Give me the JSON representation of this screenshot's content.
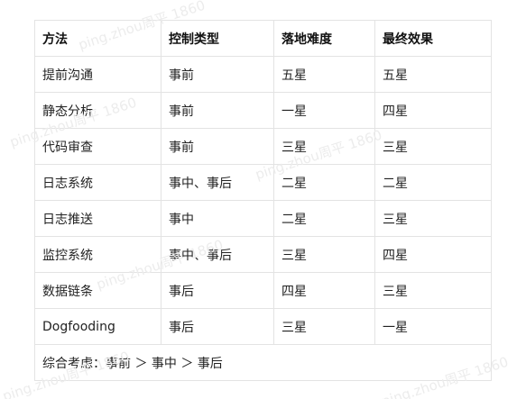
{
  "table": {
    "headers": [
      "方法",
      "控制类型",
      "落地难度",
      "最终效果"
    ],
    "rows": [
      [
        "提前沟通",
        "事前",
        "五星",
        "五星"
      ],
      [
        "静态分析",
        "事前",
        "一星",
        "四星"
      ],
      [
        "代码审查",
        "事前",
        "三星",
        "三星"
      ],
      [
        "日志系统",
        "事中、事后",
        "二星",
        "二星"
      ],
      [
        "日志推送",
        "事中",
        "二星",
        "三星"
      ],
      [
        "监控系统",
        "事中、事后",
        "三星",
        "四星"
      ],
      [
        "数据链条",
        "事后",
        "四星",
        "三星"
      ],
      [
        "Dogfooding",
        "事后",
        "三星",
        "一星"
      ]
    ],
    "summary": "综合考虑：事前 ＞ 事中 ＞ 事后"
  },
  "watermark": {
    "text": "ping.zhou周平 1860"
  }
}
